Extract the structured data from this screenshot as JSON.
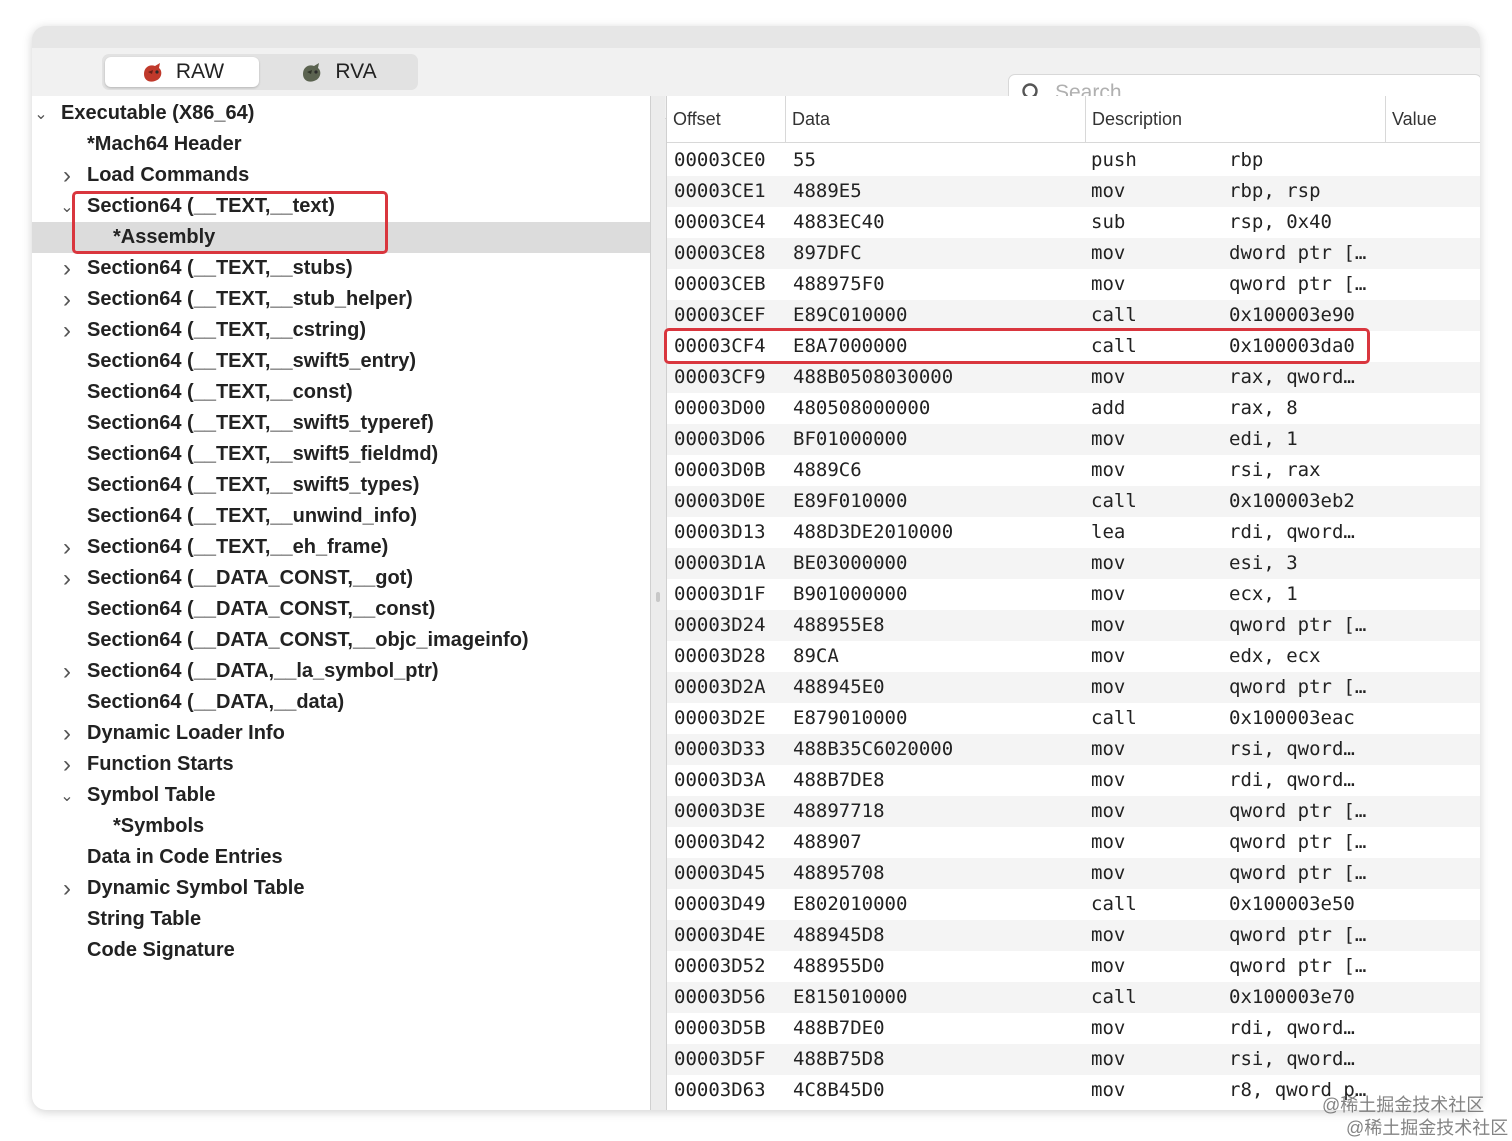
{
  "toolbar": {
    "mode_tabs": [
      {
        "label": "RAW",
        "active": true
      },
      {
        "label": "RVA",
        "active": false
      }
    ],
    "search": {
      "placeholder": "Search",
      "value": ""
    }
  },
  "tree": {
    "items": [
      {
        "label": "Executable  (X86_64)",
        "depth": 0,
        "chevron": "down"
      },
      {
        "label": "*Mach64 Header",
        "depth": 1,
        "chevron": "none"
      },
      {
        "label": "Load Commands",
        "depth": 1,
        "chevron": "right"
      },
      {
        "label": "Section64 (__TEXT,__text)",
        "depth": 1,
        "chevron": "down"
      },
      {
        "label": "*Assembly",
        "depth": 2,
        "chevron": "none",
        "selected": true
      },
      {
        "label": "Section64 (__TEXT,__stubs)",
        "depth": 1,
        "chevron": "right"
      },
      {
        "label": "Section64 (__TEXT,__stub_helper)",
        "depth": 1,
        "chevron": "right"
      },
      {
        "label": "Section64 (__TEXT,__cstring)",
        "depth": 1,
        "chevron": "right"
      },
      {
        "label": "Section64 (__TEXT,__swift5_entry)",
        "depth": 1,
        "chevron": "none"
      },
      {
        "label": "Section64 (__TEXT,__const)",
        "depth": 1,
        "chevron": "none"
      },
      {
        "label": "Section64 (__TEXT,__swift5_typeref)",
        "depth": 1,
        "chevron": "none"
      },
      {
        "label": "Section64 (__TEXT,__swift5_fieldmd)",
        "depth": 1,
        "chevron": "none"
      },
      {
        "label": "Section64 (__TEXT,__swift5_types)",
        "depth": 1,
        "chevron": "none"
      },
      {
        "label": "Section64 (__TEXT,__unwind_info)",
        "depth": 1,
        "chevron": "none"
      },
      {
        "label": "Section64 (__TEXT,__eh_frame)",
        "depth": 1,
        "chevron": "right"
      },
      {
        "label": "Section64 (__DATA_CONST,__got)",
        "depth": 1,
        "chevron": "right"
      },
      {
        "label": "Section64 (__DATA_CONST,__const)",
        "depth": 1,
        "chevron": "none"
      },
      {
        "label": "Section64 (__DATA_CONST,__objc_imageinfo)",
        "depth": 1,
        "chevron": "none"
      },
      {
        "label": "Section64 (__DATA,__la_symbol_ptr)",
        "depth": 1,
        "chevron": "right"
      },
      {
        "label": "Section64 (__DATA,__data)",
        "depth": 1,
        "chevron": "none"
      },
      {
        "label": "Dynamic Loader Info",
        "depth": 1,
        "chevron": "right"
      },
      {
        "label": "Function Starts",
        "depth": 1,
        "chevron": "right"
      },
      {
        "label": "Symbol Table",
        "depth": 1,
        "chevron": "down"
      },
      {
        "label": "*Symbols",
        "depth": 2,
        "chevron": "none"
      },
      {
        "label": "Data in Code Entries",
        "depth": 1,
        "chevron": "none"
      },
      {
        "label": "Dynamic Symbol Table",
        "depth": 1,
        "chevron": "right"
      },
      {
        "label": "String Table",
        "depth": 1,
        "chevron": "none"
      },
      {
        "label": "Code Signature",
        "depth": 1,
        "chevron": "none"
      }
    ]
  },
  "table": {
    "columns": [
      "Offset",
      "Data",
      "Description",
      "Value"
    ],
    "rows": [
      [
        "00003CE0",
        "55",
        "push",
        "rbp"
      ],
      [
        "00003CE1",
        "4889E5",
        "mov",
        "rbp, rsp"
      ],
      [
        "00003CE4",
        "4883EC40",
        "sub",
        "rsp, 0x40"
      ],
      [
        "00003CE8",
        "897DFC",
        "mov",
        "dword ptr […"
      ],
      [
        "00003CEB",
        "488975F0",
        "mov",
        "qword ptr […"
      ],
      [
        "00003CEF",
        "E89C010000",
        "call",
        "0x100003e90"
      ],
      [
        "00003CF4",
        "E8A7000000",
        "call",
        "0x100003da0"
      ],
      [
        "00003CF9",
        "488B0508030000",
        "mov",
        "rax, qword…"
      ],
      [
        "00003D00",
        "480508000000",
        "add",
        "rax, 8"
      ],
      [
        "00003D06",
        "BF01000000",
        "mov",
        "edi, 1"
      ],
      [
        "00003D0B",
        "4889C6",
        "mov",
        "rsi, rax"
      ],
      [
        "00003D0E",
        "E89F010000",
        "call",
        "0x100003eb2"
      ],
      [
        "00003D13",
        "488D3DE2010000",
        "lea",
        "rdi, qword…"
      ],
      [
        "00003D1A",
        "BE03000000",
        "mov",
        "esi, 3"
      ],
      [
        "00003D1F",
        "B901000000",
        "mov",
        "ecx, 1"
      ],
      [
        "00003D24",
        "488955E8",
        "mov",
        "qword ptr […"
      ],
      [
        "00003D28",
        "89CA",
        "mov",
        "edx, ecx"
      ],
      [
        "00003D2A",
        "488945E0",
        "mov",
        "qword ptr […"
      ],
      [
        "00003D2E",
        "E879010000",
        "call",
        "0x100003eac"
      ],
      [
        "00003D33",
        "488B35C6020000",
        "mov",
        "rsi, qword…"
      ],
      [
        "00003D3A",
        "488B7DE8",
        "mov",
        "rdi, qword…"
      ],
      [
        "00003D3E",
        "48897718",
        "mov",
        "qword ptr […"
      ],
      [
        "00003D42",
        "488907",
        "mov",
        "qword ptr […"
      ],
      [
        "00003D45",
        "48895708",
        "mov",
        "qword ptr […"
      ],
      [
        "00003D49",
        "E802010000",
        "call",
        "0x100003e50"
      ],
      [
        "00003D4E",
        "488945D8",
        "mov",
        "qword ptr […"
      ],
      [
        "00003D52",
        "488955D0",
        "mov",
        "qword ptr […"
      ],
      [
        "00003D56",
        "E815010000",
        "call",
        "0x100003e70"
      ],
      [
        "00003D5B",
        "488B7DE0",
        "mov",
        "rdi, qword…"
      ],
      [
        "00003D5F",
        "488B75D8",
        "mov",
        "rsi, qword…"
      ],
      [
        "00003D63",
        "4C8B45D0",
        "mov",
        "r8, qword p…"
      ]
    ]
  },
  "watermark": {
    "text": "@稀土掘金技术社区"
  },
  "colors": {
    "highlight": "#d9363e",
    "selected_row": "#dcdcdc",
    "alt_row": "#f4f4f4"
  }
}
